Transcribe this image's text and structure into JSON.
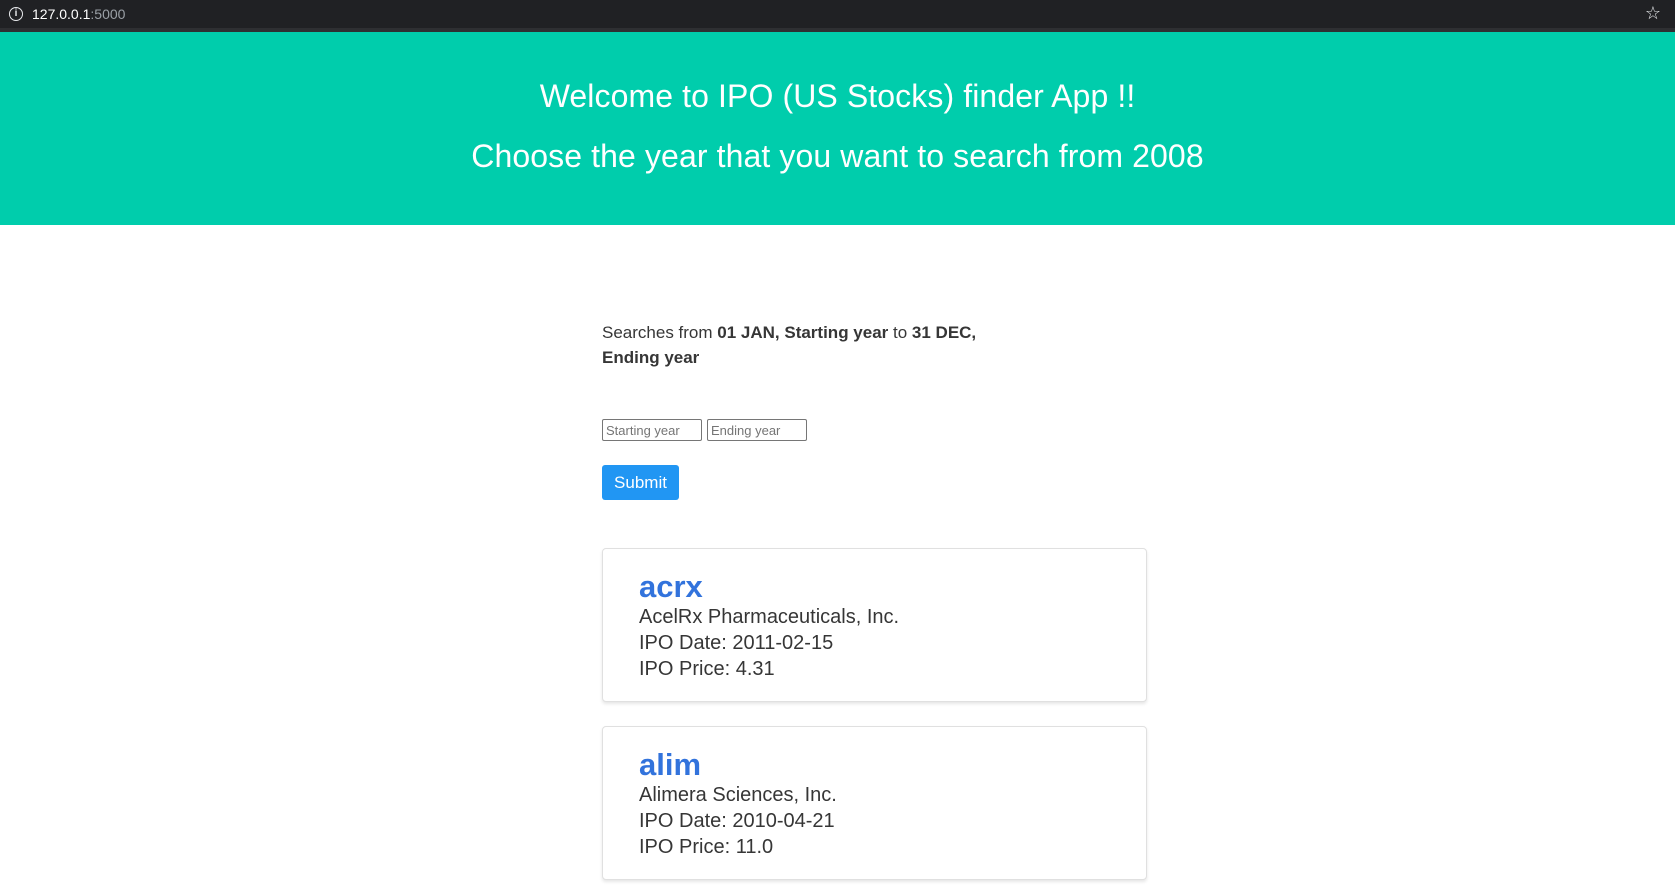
{
  "browser": {
    "url_host": "127.0.0.1",
    "url_port": ":5000"
  },
  "hero": {
    "title": "Welcome to IPO (US Stocks) finder App !!",
    "subtitle": "Choose the year that you want to search from 2008"
  },
  "search": {
    "note_prefix": "Searches from ",
    "note_start": "01 JAN, Starting year",
    "note_middle": " to ",
    "note_end": "31 DEC, Ending year",
    "start_placeholder": "Starting year",
    "end_placeholder": "Ending year",
    "submit_label": "Submit"
  },
  "results": [
    {
      "symbol": "acrx",
      "company": "AcelRx Pharmaceuticals, Inc.",
      "ipo_date": "IPO Date: 2011-02-15",
      "ipo_price": "IPO Price: 4.31"
    },
    {
      "symbol": "alim",
      "company": "Alimera Sciences, Inc.",
      "ipo_date": "IPO Date: 2010-04-21",
      "ipo_price": "IPO Price: 11.0"
    }
  ],
  "colors": {
    "hero_bg": "#00cdac",
    "link": "#3273dc",
    "button": "#2196f3"
  }
}
